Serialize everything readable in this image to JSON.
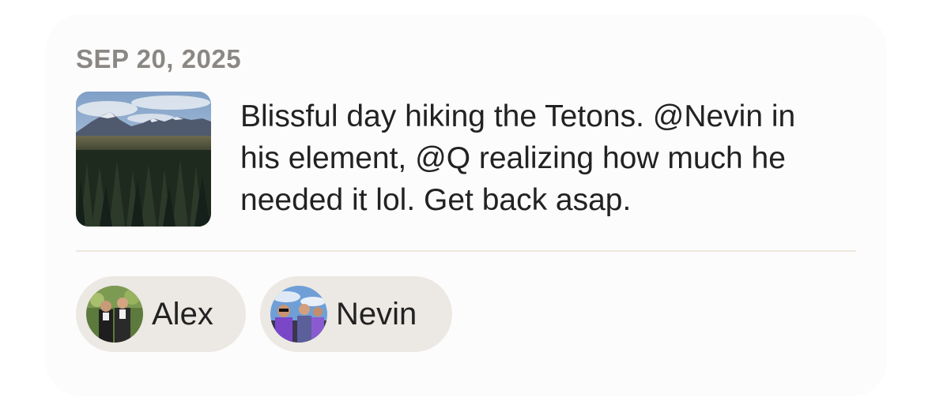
{
  "entry": {
    "date": "SEP 20, 2025",
    "text_lines": [
      "Blissful day hiking the Tetons. @Nevin in",
      "his element, @Q realizing how much he",
      "needed it lol. Get back asap."
    ]
  },
  "tagged_people": [
    {
      "name": "Alex"
    },
    {
      "name": "Nevin"
    }
  ],
  "colors": {
    "card_background": "#fcfcfc",
    "chip_background": "#ece8e3",
    "date_text": "#8a8784",
    "body_text": "#222222",
    "divider": "#efe7df"
  }
}
